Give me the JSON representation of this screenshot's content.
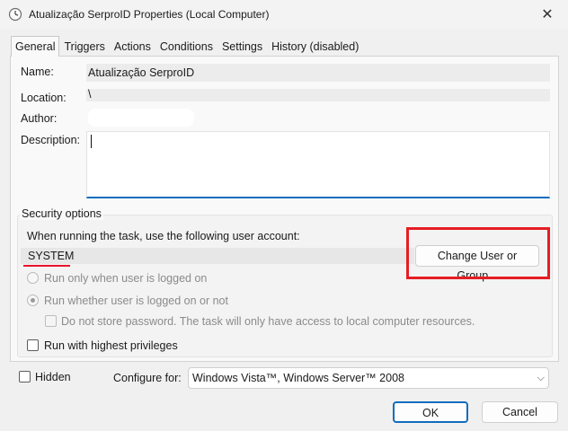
{
  "window": {
    "title": "Atualização SerproID Properties (Local Computer)",
    "close_glyph": "✕"
  },
  "tabs": [
    {
      "label": "General",
      "active": true
    },
    {
      "label": "Triggers"
    },
    {
      "label": "Actions"
    },
    {
      "label": "Conditions"
    },
    {
      "label": "Settings"
    },
    {
      "label": "History (disabled)"
    }
  ],
  "general": {
    "name_label": "Name:",
    "name_value": "Atualização SerproID",
    "location_label": "Location:",
    "location_value": "\\",
    "author_label": "Author:",
    "description_label": "Description:"
  },
  "security": {
    "group_title": "Security options",
    "account_prompt": "When running the task, use the following user account:",
    "account_value": "SYSTEM",
    "change_button": "Change User or Group...",
    "radio_logged_on": "Run only when user is logged on",
    "radio_whether": "Run whether user is logged on or not",
    "no_store_password": "Do not store password.  The task will only have access to local computer resources.",
    "highest_privileges": "Run with highest privileges"
  },
  "footer": {
    "hidden_label": "Hidden",
    "configure_label": "Configure for:",
    "configure_value": "Windows Vista™, Windows Server™ 2008",
    "ok_button": "OK",
    "cancel_button": "Cancel"
  },
  "colors": {
    "accent": "#0f6cbd",
    "annotation_red": "#e51d24"
  }
}
